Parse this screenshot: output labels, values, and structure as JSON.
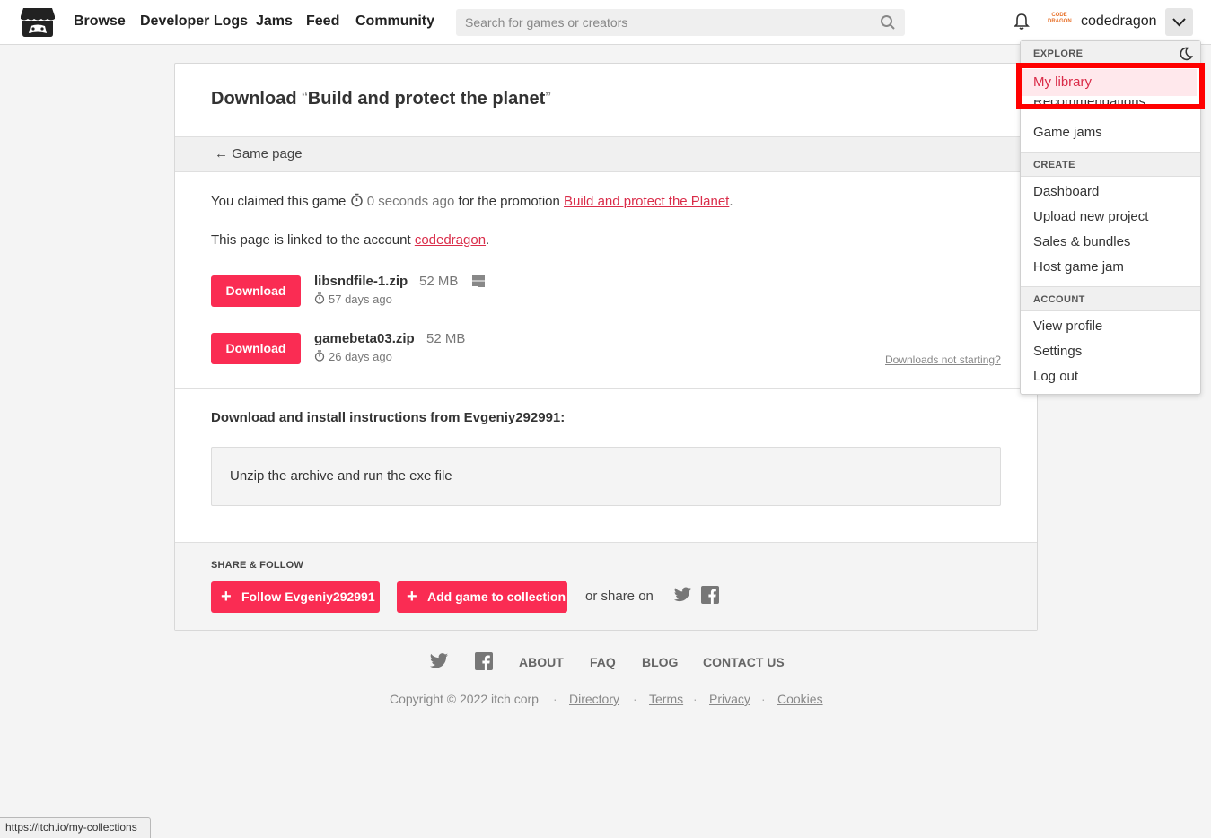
{
  "header": {
    "nav": [
      "Browse",
      "Developer Logs",
      "Jams",
      "Feed",
      "Community"
    ],
    "search_placeholder": "Search for games or creators",
    "avatar_text": "CODE DRAGON",
    "username": "codedragon"
  },
  "page": {
    "title_prefix": "Download",
    "open_quote": "“",
    "game_title": "Build and protect the planet",
    "close_quote": "”",
    "back_link": "← Game page",
    "claim_prefix": "You claimed this game",
    "claim_time": "0 seconds ago",
    "claim_mid": "for the promotion",
    "promotion_name": "Build and protect the Planet",
    "period": ".",
    "linked_prefix": "This page is linked to the account",
    "linked_account": "codedragon",
    "files": [
      {
        "button": "Download",
        "name": "libsndfile-1.zip",
        "size": "52 MB",
        "age": "57 days ago",
        "platform_icon": "windows-icon"
      },
      {
        "button": "Download",
        "name": "gamebeta03.zip",
        "size": "52 MB",
        "age": "26 days ago"
      }
    ],
    "downloads_not_starting": "Downloads not starting?",
    "instructions_heading": "Download and install instructions from Evgeniy292991:",
    "instructions_text": "Unzip the archive and run the exe file",
    "share_heading": "SHARE & FOLLOW",
    "follow_button": "Follow Evgeniy292991",
    "collection_button": "Add game to collection",
    "share_text": "or share on"
  },
  "footer": {
    "links": [
      "ABOUT",
      "FAQ",
      "BLOG",
      "CONTACT US"
    ],
    "copyright": "Copyright © 2022 itch corp",
    "legal": [
      "Directory",
      "Terms",
      "Privacy",
      "Cookies"
    ],
    "separator": "·"
  },
  "dropdown": {
    "explore_label": "EXPLORE",
    "explore_items": [
      "My library",
      "Recommendations",
      "Game jams"
    ],
    "create_label": "CREATE",
    "create_items": [
      "Dashboard",
      "Upload new project",
      "Sales & bundles",
      "Host game jam"
    ],
    "account_label": "ACCOUNT",
    "account_items": [
      "View profile",
      "Settings",
      "Log out"
    ]
  },
  "status_bar": "https://itch.io/my-collections",
  "colors": {
    "accent": "#fa2c53",
    "link": "#da2c49",
    "highlight_frame": "#ff0000"
  }
}
